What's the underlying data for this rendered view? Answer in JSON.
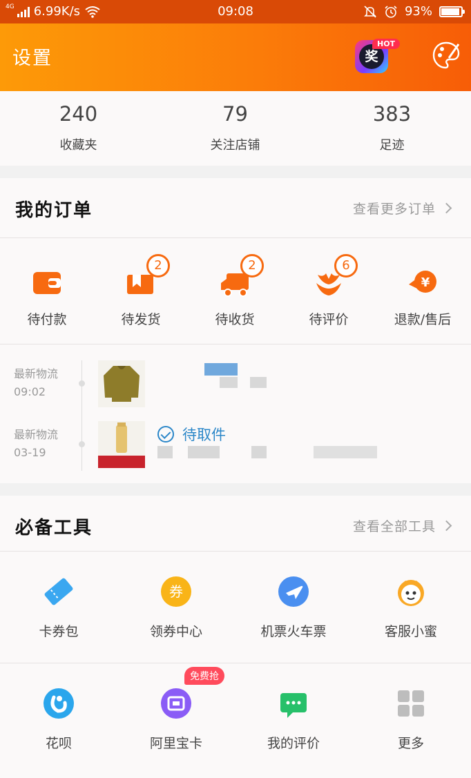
{
  "status_bar": {
    "network": "4G",
    "speed": "6.99K/s",
    "time": "09:08",
    "battery": "93%",
    "battery_level": 0.93
  },
  "header": {
    "title": "设置",
    "award_text": "奖",
    "hot_badge": "HOT"
  },
  "stats": [
    {
      "value": "240",
      "label": "收藏夹"
    },
    {
      "value": "79",
      "label": "关注店铺"
    },
    {
      "value": "383",
      "label": "足迹"
    }
  ],
  "orders": {
    "title": "我的订单",
    "more": "查看更多订单",
    "items": [
      {
        "label": "待付款",
        "badge": "",
        "icon": "wallet-icon"
      },
      {
        "label": "待发货",
        "badge": "2",
        "icon": "package-icon"
      },
      {
        "label": "待收货",
        "badge": "2",
        "icon": "truck-icon"
      },
      {
        "label": "待评价",
        "badge": "6",
        "icon": "flower-icon"
      },
      {
        "label": "退款/售后",
        "badge": "",
        "icon": "refund-icon"
      }
    ],
    "logistics": [
      {
        "label": "最新物流",
        "time": "09:02",
        "status": ""
      },
      {
        "label": "最新物流",
        "time": "03-19",
        "status": "待取件"
      }
    ]
  },
  "tools": {
    "title": "必备工具",
    "more": "查看全部工具",
    "items": [
      {
        "label": "卡券包",
        "icon": "ticket-icon",
        "color": "#3aa7f0"
      },
      {
        "label": "领券中心",
        "icon": "coupon-icon",
        "color": "#f9b418",
        "glyph": "券"
      },
      {
        "label": "机票火车票",
        "icon": "plane-icon",
        "color": "#4a8ff0"
      },
      {
        "label": "客服小蜜",
        "icon": "bee-icon",
        "color": "#f9a825"
      },
      {
        "label": "花呗",
        "icon": "huabei-icon",
        "color": "#2ba6ec"
      },
      {
        "label": "阿里宝卡",
        "icon": "card-icon",
        "color": "#8a5cf6"
      },
      {
        "label": "我的评价",
        "icon": "comment-icon",
        "color": "#27c06a"
      },
      {
        "label": "更多",
        "icon": "grid-icon",
        "color": "#bdbdbd"
      }
    ],
    "free_badge": "免费抢"
  }
}
